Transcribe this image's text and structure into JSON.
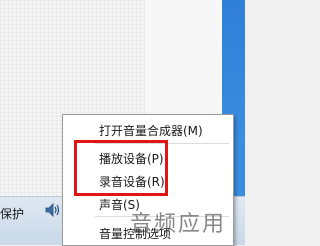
{
  "taskbar": {
    "partial_label": "保护",
    "speaker_icon": "speaker-icon"
  },
  "context_menu": {
    "items": [
      {
        "label": "打开音量合成器(M)"
      },
      {
        "label": "播放设备(P)"
      },
      {
        "label": "录音设备(R)"
      },
      {
        "label": "声音(S)"
      },
      {
        "label": "音量控制选项"
      }
    ]
  },
  "annotation": {
    "highlight_color": "#e01616"
  },
  "watermark": {
    "text": "音频应用"
  }
}
